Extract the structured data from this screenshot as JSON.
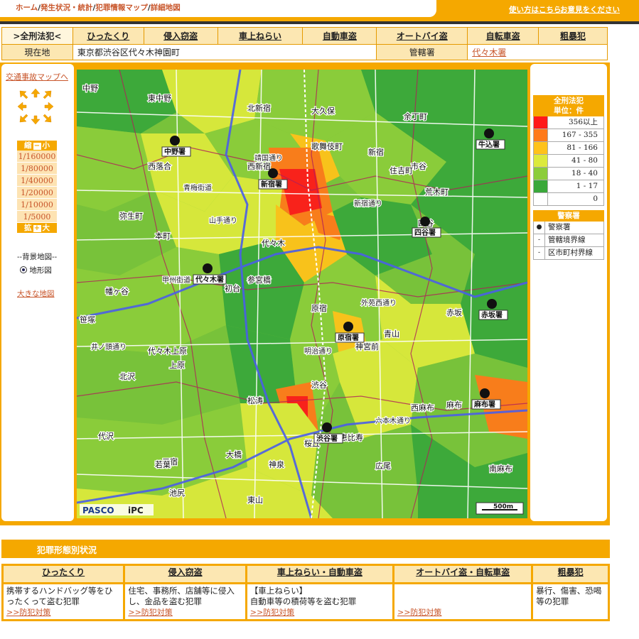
{
  "header": {
    "crumbs": [
      "ホーム",
      "発生状況・統計",
      "犯罪情報マップ",
      "詳細地図"
    ],
    "help": "使い方はこちら",
    "feedback": "お意見をください"
  },
  "categories": {
    "active": ">全刑法犯<",
    "items": [
      "ひったくり",
      "侵入窃盗",
      "車上ねらい",
      "自動車盗",
      "オートバイ盗",
      "自転車盗",
      "粗暴犯"
    ]
  },
  "location": {
    "label": "現在地",
    "value": "東京都渋谷区代々木神園町",
    "station_label": "管轄署",
    "station_value": "代々木署"
  },
  "leftpanel": {
    "traffic_link": "交通事故マップへ",
    "zoom_in": "縮",
    "zoom_small": "小",
    "zoom_out": "拡",
    "zoom_large": "大",
    "scales": [
      "1/160000",
      "1/80000",
      "1/40000",
      "1/20000",
      "1/10000",
      "1/5000"
    ],
    "bg_title": "--背景地図--",
    "bg_option": "地形図",
    "big_map": "大きな地図"
  },
  "legend": {
    "title": "全刑法犯",
    "unit": "単位：件",
    "ranges": [
      {
        "label": "356以上",
        "color": "#ff1a1a"
      },
      {
        "label": "167 - 355",
        "color": "#ff7a1a"
      },
      {
        "label": "81 - 166",
        "color": "#ffc21a"
      },
      {
        "label": "41 - 80",
        "color": "#dcea3c"
      },
      {
        "label": "18 - 40",
        "color": "#8ccd3a"
      },
      {
        "label": "1 - 17",
        "color": "#3aa83a"
      },
      {
        "label": "0",
        "color": "#ffffff"
      }
    ],
    "police_title": "警察署",
    "police_rows": [
      "警察署",
      "管轄境界線",
      "区市町村界線"
    ]
  },
  "map": {
    "stations": [
      "新宿署",
      "中野署",
      "牛込署",
      "四谷署",
      "代々木署",
      "原宿署",
      "赤坂署",
      "麻布署",
      "渋谷署"
    ],
    "places": [
      "中野",
      "東中野",
      "北新宿",
      "大久保",
      "新宿",
      "歌舞伎町",
      "西新宿",
      "代々木",
      "参宮橋",
      "初台",
      "幡ヶ谷",
      "笹塚",
      "代々木上原",
      "上原",
      "原宿",
      "神宮前",
      "渋谷",
      "松涛",
      "恵比寿",
      "広尾",
      "青山",
      "赤坂",
      "麻布",
      "四谷",
      "市谷",
      "西麻布",
      "南麻布",
      "東山",
      "池尻",
      "三宿",
      "大橋",
      "代沢",
      "北沢",
      "神泉",
      "桜丘",
      "若葉",
      "本町",
      "弥生町",
      "余丁町",
      "住吉町",
      "荒木町",
      "西落合"
    ],
    "road_labels": [
      "甲州街道",
      "青梅街道",
      "靖国通り",
      "明治通り",
      "山手通り",
      "外苑西通り",
      "六本木通り",
      "新宿通り",
      "井ノ頭通り"
    ],
    "credit": "PASCO",
    "credit2": "iPC",
    "scale": "500m"
  },
  "bottom": {
    "title": "犯罪形態別状況",
    "headers": [
      "ひったくり",
      "侵入窃盗",
      "車上ねらい・自動車盗",
      "オートバイ盗・自転車盗",
      "粗暴犯"
    ],
    "descriptions": [
      "携帯するハンドバッグ等をひったくって盗む犯罪",
      "住宅、事務所、店舗等に侵入し、金品を盗む犯罪",
      "【車上ねらい】\n自動車等の積荷等を盗む犯罪",
      "",
      "暴行、傷害、恐喝等の犯罪"
    ],
    "link": ">>防犯対策"
  }
}
